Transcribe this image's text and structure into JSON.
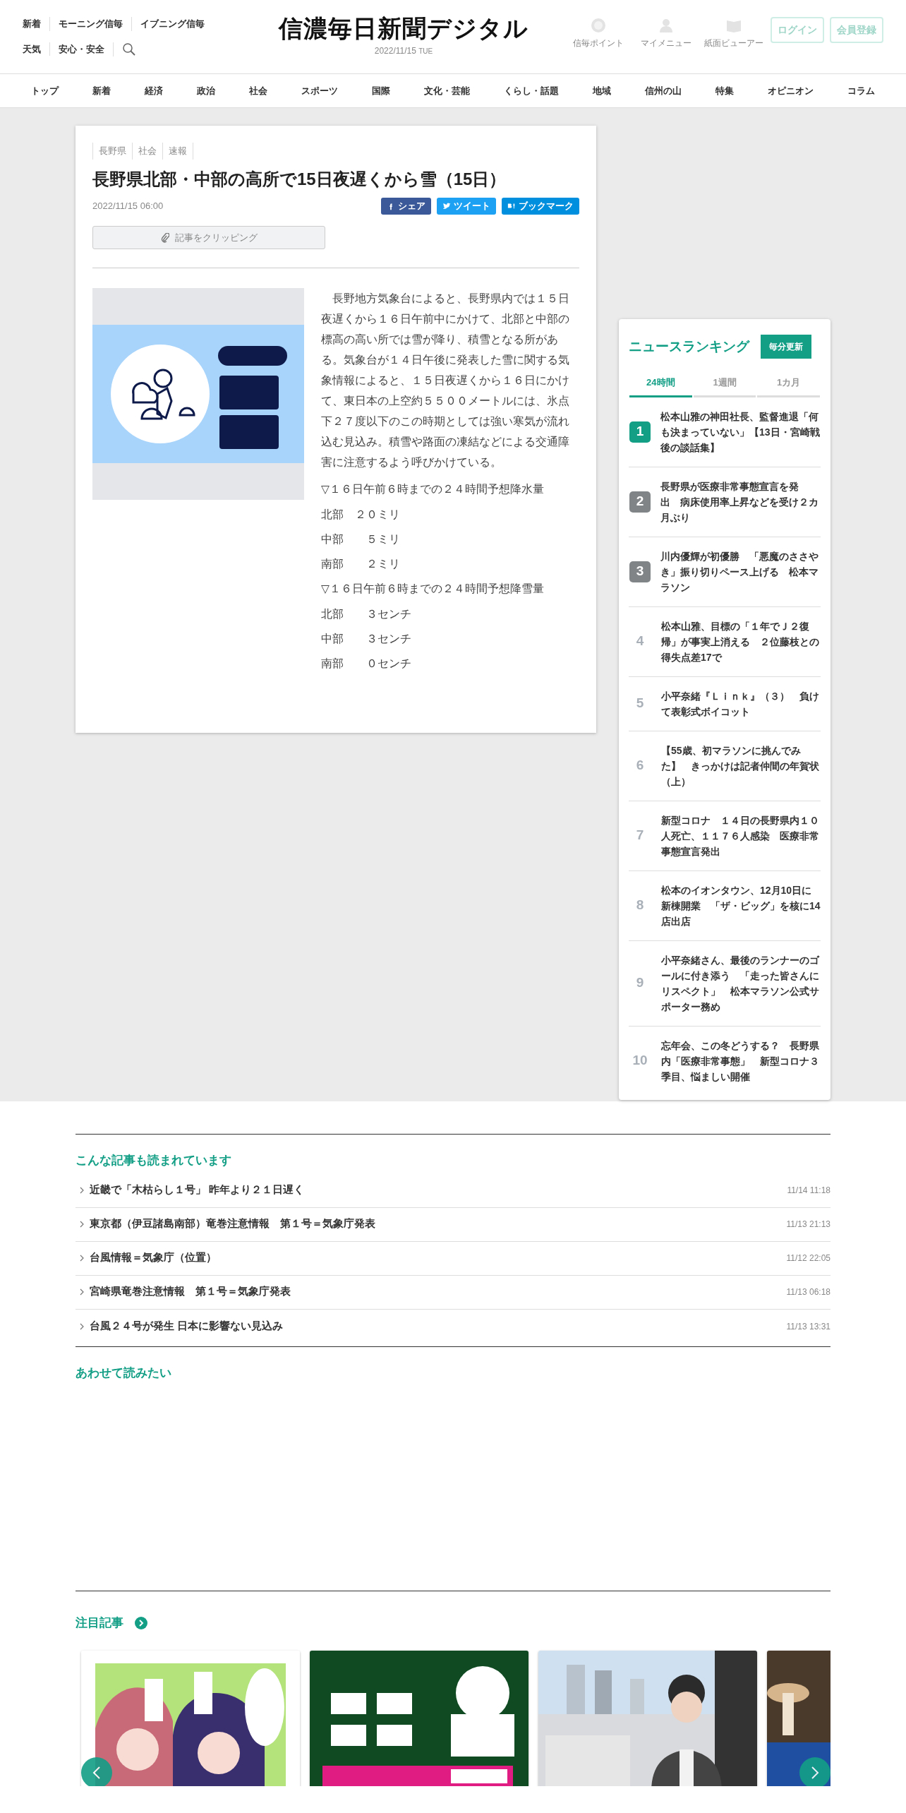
{
  "header": {
    "links_row1": [
      "新着",
      "モーニング信毎",
      "イブニング信毎"
    ],
    "links_row2": [
      "天気",
      "安心・安全"
    ],
    "logo": "信濃毎日新聞デジタル",
    "date": "2022/11/15",
    "weekday": "TUE",
    "tools": [
      {
        "kind": "point",
        "label": "信毎ポイント"
      },
      {
        "kind": "person",
        "label": "マイメニュー"
      },
      {
        "kind": "book",
        "label": "紙面ビューアー"
      }
    ],
    "buttons": [
      "ログイン",
      "会員登録"
    ]
  },
  "nav": [
    "トップ",
    "新着",
    "経済",
    "政治",
    "社会",
    "スポーツ",
    "国際",
    "文化・芸能",
    "くらし・話題",
    "地域",
    "信州の山",
    "特集",
    "オピニオン",
    "コラム"
  ],
  "article": {
    "tags": [
      "長野県",
      "社会",
      "速報"
    ],
    "title": "長野県北部・中部の高所で15日夜遅くから雪（15日）",
    "date": "2022/11/15 06:00",
    "share": [
      {
        "kind": "facebook",
        "label": "シェア"
      },
      {
        "kind": "twitter",
        "label": "ツイート"
      },
      {
        "kind": "hatena",
        "label": "ブックマーク"
      }
    ],
    "clip_button": "記事をクリッピング",
    "image": {
      "kind": "picture"
    },
    "paragraphs": [
      {
        "kind": "lead",
        "text": "　長野地方気象台によると、長野県内では１５日夜遅くから１６日午前中にかけて、北部と中部の標高の高い所では雪が降り、積雪となる所がある。気象台が１４日午後に発表した雪に関する気象情報によると、１５日夜遅くから１６日にかけて、東日本の上空約５５００メートルには、氷点下２７度以下のこの時期としては強い寒気が流れ込む見込み。積雪や路面の凍結などによる交通障害に注意するよう呼びかけている。"
      },
      {
        "kind": "line",
        "text": "▽１６日午前６時までの２４時間予想降水量"
      },
      {
        "kind": "line",
        "text": "北部　２０ミリ"
      },
      {
        "kind": "line",
        "text": "中部　　５ミリ"
      },
      {
        "kind": "line",
        "text": "南部　　２ミリ"
      },
      {
        "kind": "line",
        "text": "▽１６日午前６時までの２４時間予想降雪量"
      },
      {
        "kind": "line",
        "text": "北部　　３センチ"
      },
      {
        "kind": "line",
        "text": "中部　　３センチ"
      },
      {
        "kind": "line",
        "text": "南部　　０センチ"
      }
    ]
  },
  "ranking": {
    "title": "ニュースランキング",
    "badge": "毎分更新",
    "tabs": [
      {
        "label": "24時間",
        "selected": true
      },
      {
        "label": "1週間",
        "selected": false
      },
      {
        "label": "1カ月",
        "selected": false
      }
    ],
    "items": [
      {
        "rank": "1",
        "kind": "badge",
        "color": "#139e86",
        "title": "松本山雅の神田社長、監督進退「何も決まっていない」【13日・宮崎戦後の談話集】"
      },
      {
        "rank": "2",
        "kind": "badge",
        "color": "#808487",
        "title": "長野県が医療非常事態宣言を発出　病床使用率上昇などを受け２カ月ぶり"
      },
      {
        "rank": "3",
        "kind": "badge",
        "color": "#808487",
        "title": "川内優輝が初優勝　「悪魔のささやき」振り切りペース上げる　松本マラソン"
      },
      {
        "rank": "4",
        "kind": "plain",
        "title": "松本山雅、目標の「１年でＪ２復帰」が事実上消える　２位藤枝との得失点差17で"
      },
      {
        "rank": "5",
        "kind": "plain",
        "title": "小平奈緒『Ｌｉｎｋ』（３）　負けて表彰式ボイコット"
      },
      {
        "rank": "6",
        "kind": "plain",
        "title": "【55歳、初マラソンに挑んでみた】　きっかけは記者仲間の年賀状（上）"
      },
      {
        "rank": "7",
        "kind": "plain",
        "title": "新型コロナ　１４日の長野県内１０人死亡、１１７６人感染　医療非常事態宣言発出"
      },
      {
        "rank": "8",
        "kind": "plain",
        "title": "松本のイオンタウン、12月10日に新棟開業　「ザ・ビッグ」を核に14店出店"
      },
      {
        "rank": "9",
        "kind": "plain",
        "title": "小平奈緒さん、最後のランナーのゴールに付き添う　「走った皆さんにリスペクト」　松本マラソン公式サポーター務め"
      },
      {
        "rank": "10",
        "kind": "plain",
        "title": "忘年会、この冬どうする？　長野県内「医療非常事態」　新型コロナ３季目、悩ましい開催"
      }
    ]
  },
  "popular": {
    "title": "こんな記事も読まれています",
    "items": [
      {
        "title": "近畿で「木枯らし１号」 昨年より２１日遅く",
        "time": "11/14 11:18"
      },
      {
        "title": "東京都（伊豆諸島南部）竜巻注意情報　第１号＝気象庁発表",
        "time": "11/13 21:13"
      },
      {
        "title": "台風情報＝気象庁（位置）",
        "time": "11/12 22:05"
      },
      {
        "title": "宮崎県竜巻注意情報　第１号＝気象庁発表",
        "time": "11/13 06:18"
      },
      {
        "title": "台風２４号が発生 日本に影響ない見込み",
        "time": "11/13 13:31"
      }
    ]
  },
  "recommended": {
    "title": "あわせて読みたい"
  },
  "featured": {
    "title": "注目記事",
    "cards": [
      {
        "kind": "picture"
      },
      {
        "kind": "picture"
      },
      {
        "kind": "picture"
      },
      {
        "kind": "picture"
      }
    ]
  }
}
